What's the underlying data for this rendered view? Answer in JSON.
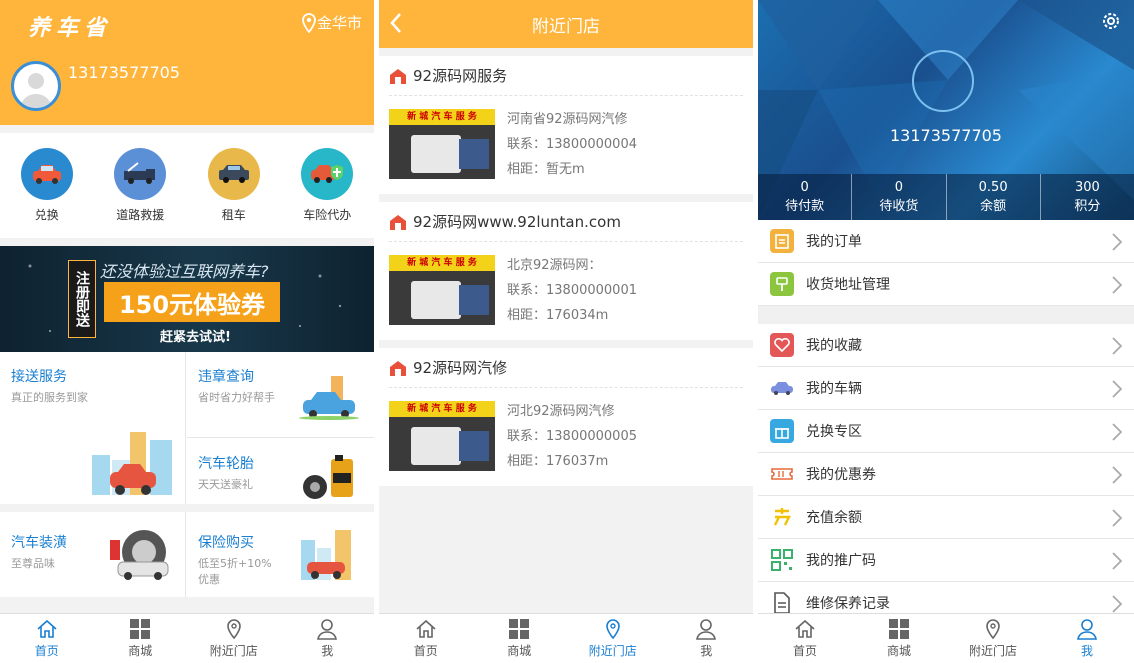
{
  "home": {
    "logo": "养车省",
    "city": "金华市",
    "phone": "13173577705",
    "services": [
      {
        "label": "兑换",
        "color": "#2a8ad0"
      },
      {
        "label": "道路救援",
        "color": "#5b8fd6"
      },
      {
        "label": "租车",
        "color": "#e8b84a"
      },
      {
        "label": "车险代办",
        "color": "#27b7c9"
      }
    ],
    "banner": {
      "register": "注册即送",
      "line1": "还没体验过互联网养车?",
      "coupon": "150元体验券",
      "line2": "赶紧去试试!"
    },
    "tiles": [
      {
        "title": "接送服务",
        "sub": "真正的服务到家"
      },
      {
        "title": "违章查询",
        "sub": "省时省力好帮手"
      },
      {
        "title": "汽车轮胎",
        "sub": "天天送豪礼"
      },
      {
        "title": "汽车装潢",
        "sub": "至尊品味"
      },
      {
        "title": "保险购买",
        "sub": "低至5折+10%",
        "sub2": "优惠"
      }
    ]
  },
  "nearby": {
    "title": "附近门店",
    "stores": [
      {
        "name": "92源码网服务",
        "address": "河南省92源码网汽修",
        "contact": "联系：13800000004",
        "distance": "相距：暂无m",
        "sign": "新 城 汽 车 服 务"
      },
      {
        "name": "92源码网www.92luntan.com",
        "address": "北京92源码网：",
        "contact": "联系：13800000001",
        "distance": "相距：176034m",
        "sign": "新 城 汽 车 服 务"
      },
      {
        "name": "92源码网汽修",
        "address": "河北92源码网汽修",
        "contact": "联系：13800000005",
        "distance": "相距：176037m",
        "sign": "新 城 汽 车 服 务"
      }
    ]
  },
  "me": {
    "phone": "13173577705",
    "stats": [
      {
        "value": "0",
        "label": "待付款"
      },
      {
        "value": "0",
        "label": "待收货"
      },
      {
        "value": "0.50",
        "label": "余额"
      },
      {
        "value": "300",
        "label": "积分"
      }
    ],
    "menu1": [
      {
        "label": "我的订单",
        "color": "#f3b23d"
      },
      {
        "label": "收货地址管理",
        "color": "#8cc63f"
      }
    ],
    "menu2": [
      {
        "label": "我的收藏",
        "color": "#e45757"
      },
      {
        "label": "我的车辆",
        "color": "#7a8fe0"
      },
      {
        "label": "兑换专区",
        "color": "#37a8e0"
      },
      {
        "label": "我的优惠券",
        "color": "#e86a3a"
      },
      {
        "label": "充值余额",
        "color": "#f2c200"
      },
      {
        "label": "我的推广码",
        "color": "#3bb26b"
      },
      {
        "label": "维修保养记录",
        "color": "#555555"
      }
    ]
  },
  "tabs": [
    {
      "label": "首页",
      "icon": "home-icon"
    },
    {
      "label": "商城",
      "icon": "grid-icon"
    },
    {
      "label": "附近门店",
      "icon": "location-icon"
    },
    {
      "label": "我",
      "icon": "user-icon"
    }
  ],
  "colors": {
    "accent": "#ffb53c",
    "active": "#1a7fd1"
  }
}
